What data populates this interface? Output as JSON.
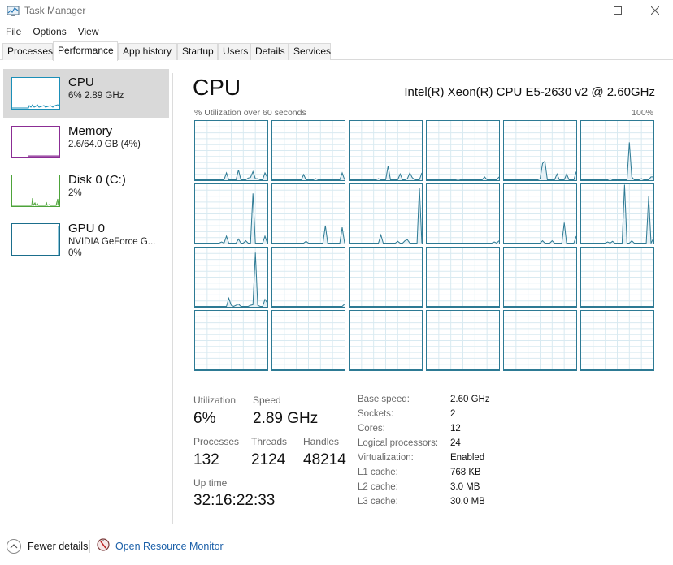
{
  "window": {
    "title": "Task Manager",
    "controls": {
      "minimize": "minimize",
      "maximize": "maximize",
      "close": "close"
    }
  },
  "menu": [
    "File",
    "Options",
    "View"
  ],
  "tabs": [
    {
      "label": "Processes",
      "active": false
    },
    {
      "label": "Performance",
      "active": true
    },
    {
      "label": "App history",
      "active": false
    },
    {
      "label": "Startup",
      "active": false
    },
    {
      "label": "Users",
      "active": false
    },
    {
      "label": "Details",
      "active": false
    },
    {
      "label": "Services",
      "active": false
    }
  ],
  "sidebar": [
    {
      "name": "CPU",
      "sub1": "6%  2.89 GHz",
      "sub2": "",
      "color": "#1b8fb8",
      "selected": true
    },
    {
      "name": "Memory",
      "sub1": "2.6/64.0 GB (4%)",
      "sub2": "",
      "color": "#8b2d94",
      "selected": false
    },
    {
      "name": "Disk 0 (C:)",
      "sub1": "2%",
      "sub2": "",
      "color": "#4da33a",
      "selected": false
    },
    {
      "name": "GPU 0",
      "sub1": "NVIDIA GeForce G...",
      "sub2": "0%",
      "color": "#1b6e8c",
      "selected": false
    }
  ],
  "main": {
    "title": "CPU",
    "model": "Intel(R) Xeon(R) CPU E5-2630 v2 @ 2.60GHz",
    "graph_label": "% Utilization over 60 seconds",
    "graph_max": "100%",
    "graph_color": "#2d7a94"
  },
  "stats": {
    "utilization": {
      "label": "Utilization",
      "value": "6%"
    },
    "speed": {
      "label": "Speed",
      "value": "2.89 GHz"
    },
    "processes": {
      "label": "Processes",
      "value": "132"
    },
    "threads": {
      "label": "Threads",
      "value": "2124"
    },
    "handles": {
      "label": "Handles",
      "value": "48214"
    },
    "uptime": {
      "label": "Up time",
      "value": "32:16:22:33"
    }
  },
  "specs": [
    {
      "label": "Base speed:",
      "value": "2.60 GHz"
    },
    {
      "label": "Sockets:",
      "value": "2"
    },
    {
      "label": "Cores:",
      "value": "12"
    },
    {
      "label": "Logical processors:",
      "value": "24"
    },
    {
      "label": "Virtualization:",
      "value": "Enabled"
    },
    {
      "label": "L1 cache:",
      "value": "768 KB"
    },
    {
      "label": "L2 cache:",
      "value": "3.0 MB"
    },
    {
      "label": "L3 cache:",
      "value": "30.0 MB"
    }
  ],
  "footer": {
    "fewer_details": "Fewer details",
    "resource_monitor": "Open Resource Monitor"
  },
  "chart_data": {
    "type": "line",
    "title": "% Utilization over 60 seconds",
    "ylim": [
      0,
      100
    ],
    "x_seconds": 60,
    "grid": true,
    "series_note": "24 logical processor mini-graphs, values approximate (% per sample, ~30 samples each)",
    "series": [
      {
        "name": "CPU 0",
        "values": [
          0,
          0,
          0,
          0,
          0,
          0,
          0,
          0,
          0,
          0,
          0,
          0,
          0,
          12,
          0,
          0,
          0,
          0,
          17,
          0,
          0,
          0,
          3,
          4,
          14,
          2,
          2,
          0,
          0,
          12,
          4
        ]
      },
      {
        "name": "CPU 1",
        "values": [
          0,
          0,
          0,
          0,
          0,
          0,
          0,
          0,
          0,
          0,
          0,
          0,
          0,
          9,
          0,
          0,
          0,
          0,
          2,
          0,
          0,
          0,
          0,
          0,
          0,
          0,
          0,
          0,
          0,
          12,
          0
        ]
      },
      {
        "name": "CPU 2",
        "values": [
          0,
          0,
          0,
          0,
          0,
          0,
          0,
          0,
          0,
          0,
          0,
          0,
          2,
          0,
          0,
          0,
          24,
          0,
          0,
          0,
          0,
          10,
          0,
          0,
          2,
          12,
          4,
          0,
          0,
          0,
          12
        ]
      },
      {
        "name": "CPU 3",
        "values": [
          0,
          0,
          0,
          0,
          0,
          0,
          0,
          0,
          0,
          0,
          0,
          0,
          0,
          1,
          0,
          0,
          0,
          0,
          0,
          0,
          0,
          0,
          0,
          0,
          5,
          0,
          0,
          0,
          0,
          0,
          5
        ]
      },
      {
        "name": "CPU 4",
        "values": [
          0,
          0,
          0,
          0,
          0,
          0,
          0,
          0,
          0,
          0,
          0,
          0,
          0,
          0,
          0,
          2,
          28,
          32,
          0,
          0,
          0,
          0,
          10,
          0,
          0,
          0,
          10,
          0,
          0,
          0,
          14
        ]
      },
      {
        "name": "CPU 5",
        "values": [
          0,
          0,
          0,
          0,
          0,
          0,
          0,
          0,
          0,
          0,
          0,
          0,
          2,
          0,
          0,
          0,
          0,
          0,
          0,
          0,
          64,
          5,
          0,
          0,
          0,
          2,
          0,
          0,
          0,
          5,
          5
        ]
      },
      {
        "name": "CPU 6",
        "values": [
          0,
          0,
          0,
          0,
          0,
          0,
          0,
          0,
          0,
          0,
          0,
          2,
          0,
          12,
          0,
          0,
          0,
          0,
          7,
          0,
          0,
          4,
          0,
          0,
          85,
          0,
          0,
          0,
          0,
          12,
          0
        ]
      },
      {
        "name": "CPU 7",
        "values": [
          0,
          0,
          0,
          0,
          0,
          0,
          0,
          0,
          0,
          0,
          0,
          0,
          0,
          0,
          3,
          0,
          0,
          0,
          0,
          0,
          0,
          0,
          30,
          0,
          0,
          0,
          0,
          0,
          0,
          27,
          0
        ]
      },
      {
        "name": "CPU 8",
        "values": [
          0,
          0,
          0,
          0,
          0,
          0,
          0,
          0,
          0,
          0,
          0,
          0,
          0,
          14,
          0,
          0,
          0,
          0,
          0,
          0,
          3,
          0,
          0,
          4,
          6,
          0,
          0,
          0,
          0,
          95,
          0
        ]
      },
      {
        "name": "CPU 9",
        "values": [
          0,
          0,
          0,
          0,
          0,
          0,
          0,
          0,
          0,
          0,
          0,
          0,
          0,
          0,
          0,
          0,
          0,
          0,
          0,
          0,
          0,
          0,
          0,
          0,
          0,
          0,
          0,
          0,
          2,
          0,
          4
        ]
      },
      {
        "name": "CPU 10",
        "values": [
          0,
          0,
          0,
          0,
          0,
          0,
          0,
          0,
          0,
          0,
          0,
          0,
          0,
          0,
          0,
          0,
          4,
          0,
          0,
          0,
          4,
          0,
          0,
          0,
          0,
          35,
          0,
          0,
          0,
          0,
          12
        ]
      },
      {
        "name": "CPU 11",
        "values": [
          0,
          0,
          0,
          0,
          0,
          0,
          0,
          0,
          0,
          0,
          0,
          2,
          0,
          3,
          0,
          0,
          0,
          0,
          100,
          0,
          0,
          4,
          0,
          0,
          0,
          0,
          0,
          0,
          80,
          0,
          8
        ]
      },
      {
        "name": "CPU 12",
        "values": [
          0,
          0,
          0,
          0,
          0,
          0,
          0,
          0,
          0,
          0,
          0,
          0,
          0,
          0,
          14,
          2,
          0,
          2,
          4,
          0,
          0,
          0,
          0,
          2,
          3,
          92,
          2,
          0,
          0,
          12,
          6
        ]
      },
      {
        "name": "CPU 13",
        "values": [
          0,
          0,
          0,
          0,
          0,
          0,
          0,
          0,
          0,
          0,
          0,
          0,
          0,
          0,
          0,
          0,
          0,
          0,
          0,
          0,
          0,
          0,
          0,
          0,
          0,
          0,
          0,
          0,
          0,
          0,
          4
        ]
      },
      {
        "name": "CPU 14",
        "values": [
          0,
          0,
          0,
          0,
          0,
          0,
          0,
          0,
          0,
          0,
          0,
          0,
          0,
          0,
          0,
          0,
          0,
          0,
          0,
          0,
          0,
          0,
          0,
          0,
          0,
          0,
          0,
          0,
          0,
          0,
          0
        ]
      },
      {
        "name": "CPU 15",
        "values": [
          0,
          0,
          0,
          0,
          0,
          0,
          0,
          0,
          0,
          0,
          0,
          0,
          0,
          0,
          0,
          0,
          0,
          0,
          0,
          0,
          0,
          0,
          0,
          0,
          0,
          0,
          0,
          0,
          0,
          0,
          0
        ]
      },
      {
        "name": "CPU 16",
        "values": [
          0,
          0,
          0,
          0,
          0,
          0,
          0,
          0,
          0,
          0,
          0,
          0,
          0,
          0,
          0,
          0,
          0,
          0,
          0,
          0,
          0,
          0,
          0,
          0,
          0,
          0,
          0,
          0,
          0,
          0,
          0
        ]
      },
      {
        "name": "CPU 17",
        "values": [
          0,
          0,
          0,
          0,
          0,
          0,
          0,
          0,
          0,
          0,
          0,
          0,
          0,
          0,
          0,
          0,
          0,
          0,
          0,
          0,
          0,
          0,
          0,
          0,
          0,
          0,
          0,
          0,
          0,
          0,
          0
        ]
      },
      {
        "name": "CPU 18",
        "values": [
          0,
          0,
          0,
          0,
          0,
          0,
          0,
          0,
          0,
          0,
          0,
          0,
          0,
          0,
          0,
          0,
          0,
          0,
          0,
          0,
          0,
          0,
          0,
          0,
          0,
          0,
          0,
          0,
          0,
          0,
          0
        ]
      },
      {
        "name": "CPU 19",
        "values": [
          0,
          0,
          0,
          0,
          0,
          0,
          0,
          0,
          0,
          0,
          0,
          0,
          0,
          0,
          0,
          0,
          0,
          0,
          0,
          0,
          0,
          0,
          0,
          0,
          0,
          0,
          0,
          0,
          0,
          0,
          0
        ]
      },
      {
        "name": "CPU 20",
        "values": [
          0,
          0,
          0,
          0,
          0,
          0,
          0,
          0,
          0,
          0,
          0,
          0,
          0,
          0,
          0,
          0,
          0,
          0,
          0,
          0,
          0,
          0,
          0,
          0,
          0,
          0,
          0,
          0,
          0,
          0,
          0
        ]
      },
      {
        "name": "CPU 21",
        "values": [
          0,
          0,
          0,
          0,
          0,
          0,
          0,
          0,
          0,
          0,
          0,
          0,
          0,
          0,
          0,
          0,
          0,
          0,
          0,
          0,
          0,
          0,
          0,
          0,
          0,
          0,
          0,
          0,
          0,
          0,
          0
        ]
      },
      {
        "name": "CPU 22",
        "values": [
          0,
          0,
          0,
          0,
          0,
          0,
          0,
          0,
          0,
          0,
          0,
          0,
          0,
          0,
          0,
          0,
          0,
          0,
          0,
          0,
          0,
          0,
          0,
          0,
          0,
          0,
          0,
          0,
          0,
          0,
          0
        ]
      },
      {
        "name": "CPU 23",
        "values": [
          0,
          0,
          0,
          0,
          0,
          0,
          0,
          0,
          0,
          0,
          0,
          0,
          0,
          0,
          0,
          0,
          0,
          0,
          0,
          0,
          0,
          0,
          0,
          0,
          0,
          0,
          0,
          0,
          0,
          0,
          0
        ]
      }
    ]
  }
}
